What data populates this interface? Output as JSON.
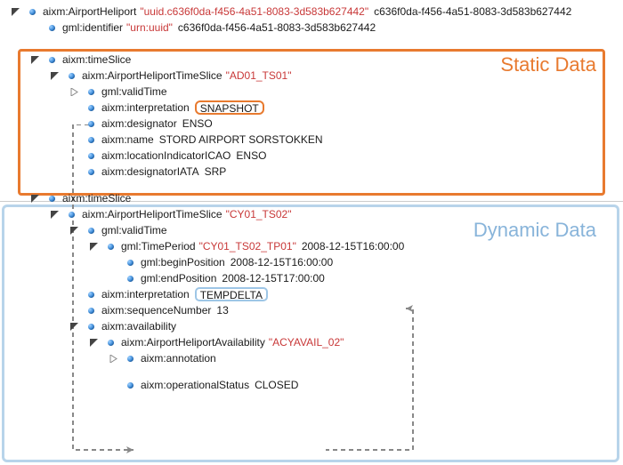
{
  "sections": {
    "static_label": "Static Data",
    "dynamic_label": "Dynamic Data"
  },
  "root": {
    "key": "aixm:AirportHeliport",
    "attr": "\"uuid.c636f0da-f456-4a51-8083-3d583b627442\"",
    "val": "c636f0da-f456-4a51-8083-3d583b627442"
  },
  "identifier": {
    "key": "gml:identifier",
    "attr": "\"urn:uuid\"",
    "val": "c636f0da-f456-4a51-8083-3d583b627442"
  },
  "ts1": {
    "timeslice_key": "aixm:timeSlice",
    "slice_key": "aixm:AirportHeliportTimeSlice",
    "slice_attr": "\"AD01_TS01\"",
    "validtime_key": "gml:validTime",
    "interp_key": "aixm:interpretation",
    "interp_val": "SNAPSHOT",
    "designator_key": "aixm:designator",
    "designator_val": "ENSO",
    "name_key": "aixm:name",
    "name_val": "STORD AIRPORT SORSTOKKEN",
    "icao_key": "aixm:locationIndicatorICAO",
    "icao_val": "ENSO",
    "iata_key": "aixm:designatorIATA",
    "iata_val": "SRP"
  },
  "ts2": {
    "timeslice_key": "aixm:timeSlice",
    "slice_key": "aixm:AirportHeliportTimeSlice",
    "slice_attr": "\"CY01_TS02\"",
    "validtime_key": "gml:validTime",
    "tp_key": "gml:TimePeriod",
    "tp_attr": "\"CY01_TS02_TP01\"",
    "tp_val": "2008-12-15T16:00:00",
    "begin_key": "gml:beginPosition",
    "begin_val": "2008-12-15T16:00:00",
    "end_key": "gml:endPosition",
    "end_val": "2008-12-15T17:00:00",
    "interp_key": "aixm:interpretation",
    "interp_val": "TEMPDELTA",
    "seq_key": "aixm:sequenceNumber",
    "seq_val": "13",
    "avail_key": "aixm:availability",
    "aha_key": "aixm:AirportHeliportAvailability",
    "aha_attr": "\"ACYAVAIL_02\"",
    "ann_key": "aixm:annotation",
    "op_key": "aixm:operationalStatus",
    "op_val": "CLOSED"
  }
}
